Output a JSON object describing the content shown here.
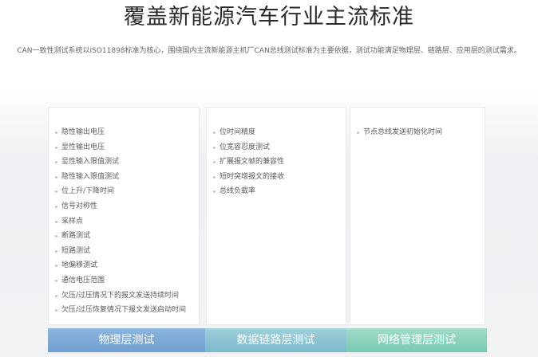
{
  "heading": {
    "title": "覆盖新能源汽车行业主流标准",
    "description": "CAN一致性测试系统以ISO11898标准为核心，围绕国内主流新能源主机厂CAN总线测试标准为主要依据，测试功能满足物理层、链路层、应用层的测试需求。"
  },
  "columns": [
    {
      "items": [
        "隐性输出电压",
        "显性输出电压",
        "显性输入限值测试",
        "隐性输入限值测试",
        "位上升/下降时间",
        "信号对称性",
        "采样点",
        "断路测试",
        "短路测试",
        "地偏移测试",
        "通信电压范围",
        "欠压/过压情况下的报文发送持续时间",
        "欠压/过压恢复情况下报文发送启动时间"
      ]
    },
    {
      "items": [
        "位时间精度",
        "位宽容忍度测试",
        "扩展报文帧的兼容性",
        "短时突增报文的接收",
        "总线负载率"
      ]
    },
    {
      "items": [
        "节点总线发送初始化时间"
      ]
    }
  ],
  "tabs": [
    {
      "label": "物理层测试",
      "color": "#7ea9d8"
    },
    {
      "label": "数据链路层测试",
      "color": "#8cc4d3"
    },
    {
      "label": "网络管理层测试",
      "color": "#8bd2bd"
    }
  ]
}
